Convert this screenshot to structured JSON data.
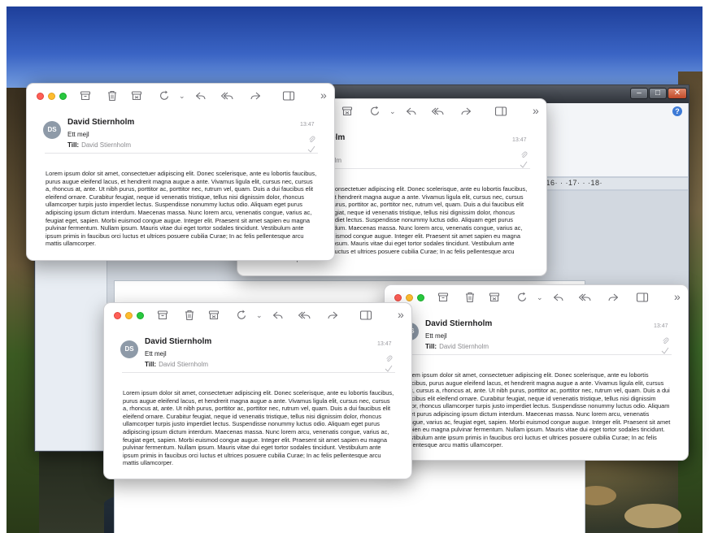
{
  "email": {
    "avatar_initials": "DS",
    "sender": "David Stiernholm",
    "subject": "Ett mejl",
    "to_label": "Till:",
    "to_name": "David Stiernholm",
    "time": "13:47",
    "body": "Lorem ipsum dolor sit amet, consectetuer adipiscing elit. Donec scelerisque, ante eu lobortis faucibus, purus augue eleifend lacus, et hendrerit magna augue a ante. Vivamus ligula elit, cursus nec, cursus a, rhoncus at, ante. Ut nibh purus, porttitor ac, porttitor nec, rutrum vel, quam. Duis a dui faucibus elit eleifend ornare. Curabitur feugiat, neque id venenatis tristique, tellus nisi dignissim dolor, rhoncus ullamcorper turpis justo imperdiet lectus. Suspendisse nonummy luctus odio. Aliquam eget purus adipiscing ipsum dictum interdum. Maecenas massa. Nunc lorem arcu, venenatis congue, varius ac, feugiat eget, sapien.   Morbi euismod congue augue. Integer elit. Praesent sit amet sapien eu magna pulvinar fermentum. Nullam ipsum. Mauris vitae dui eget tortor sodales tincidunt. Vestibulum ante ipsum primis in faucibus orci luctus et ultrices posuere cubilia Curae; In ac felis pellentesque arcu mattis ullamcorper."
  },
  "toolbar": {
    "icons": [
      "archive-icon",
      "trash-icon",
      "junk-icon",
      "flag-icon",
      "chevron-down-icon",
      "reply-icon",
      "reply-all-icon",
      "forward-icon",
      "sidebar-icon",
      "more-icon"
    ],
    "more_label": "»",
    "chevron_label": "⌄"
  },
  "legacy_window": {
    "minimize_label": "–",
    "maximize_label": "□",
    "close_label": "✕",
    "help_label": "?",
    "ruler_text": "·16· · ·17· · ·18·"
  }
}
